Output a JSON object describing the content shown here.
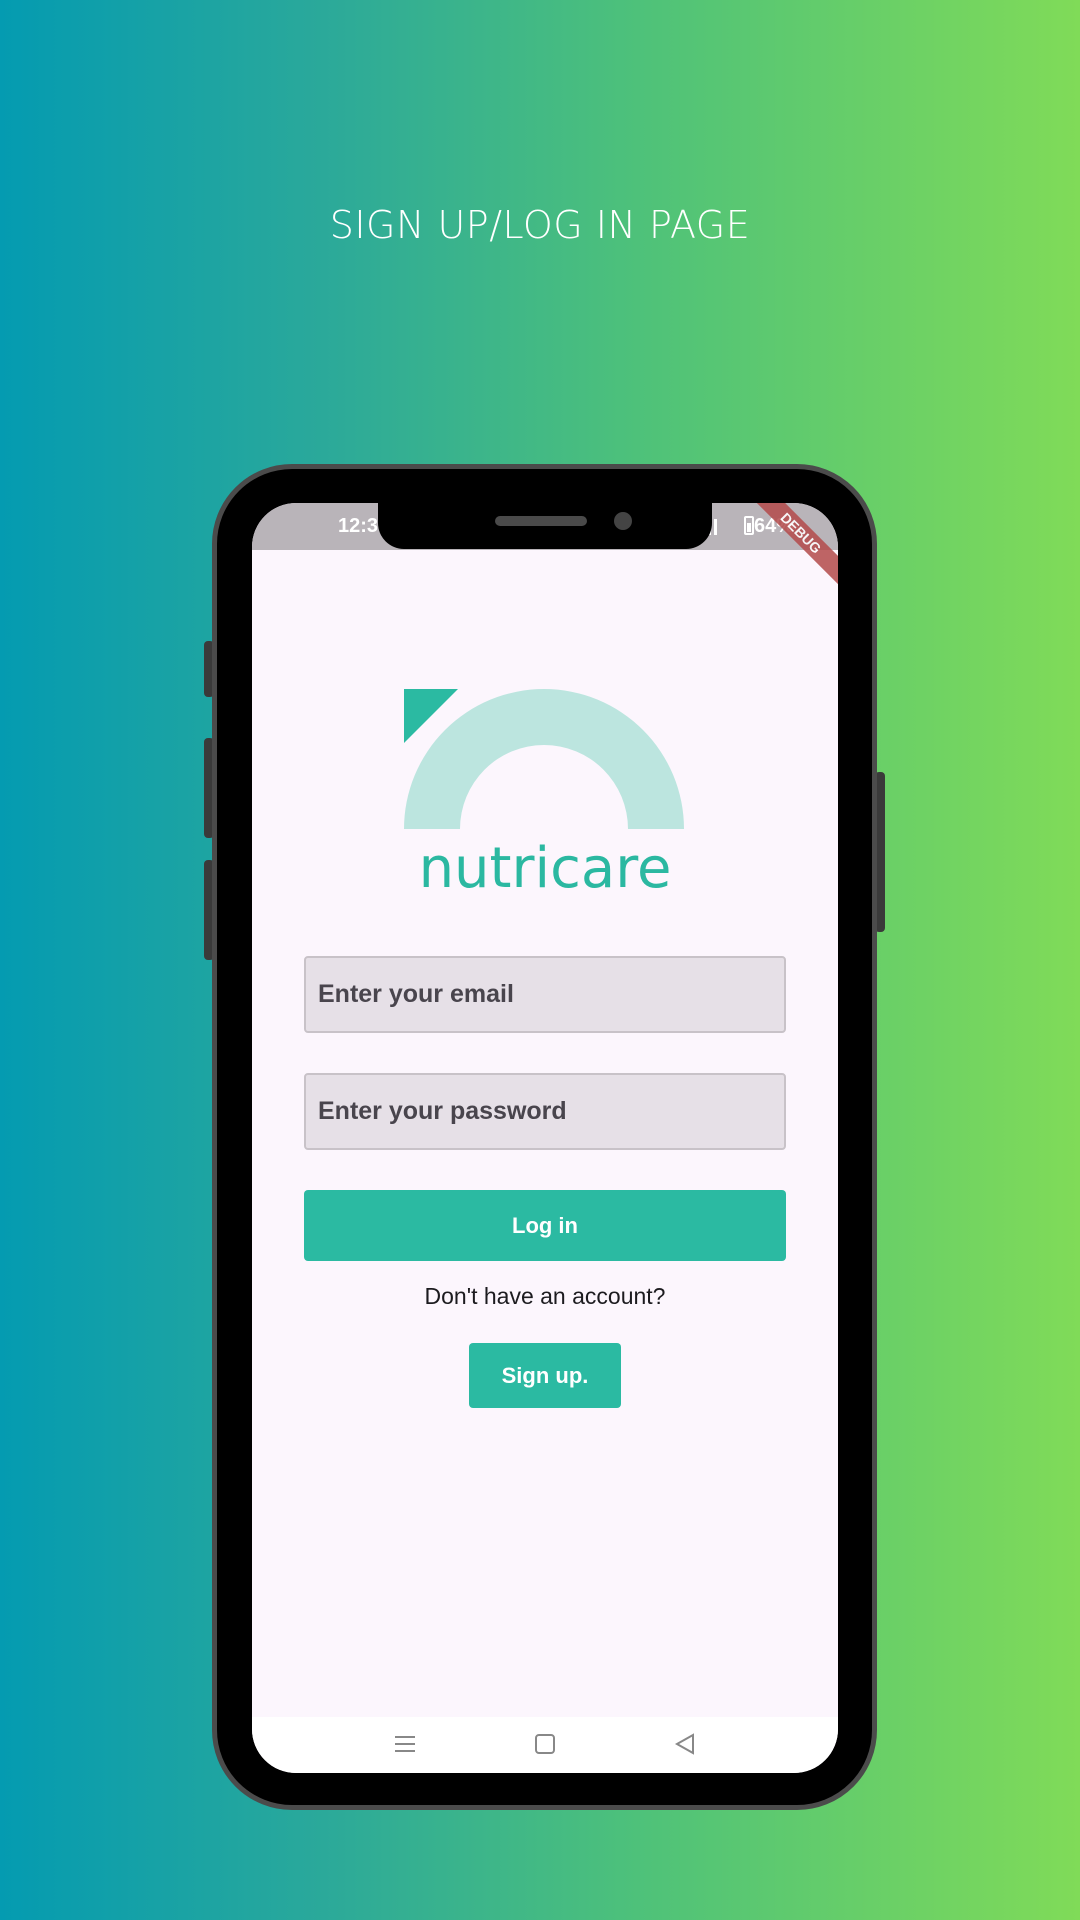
{
  "heading": "SIGN UP/LOG IN PAGE",
  "status": {
    "time": "12:3",
    "battery": "64%"
  },
  "debug_banner": "DEBUG",
  "brand": {
    "name": "nutricare",
    "color": "#2bb8a1"
  },
  "form": {
    "email_placeholder": "Enter your email",
    "password_placeholder": "Enter your password",
    "login_label": "Log in",
    "account_prompt": "Don't have an account?",
    "signup_label": "Sign up."
  },
  "nav": {
    "menu_icon": "menu-icon",
    "home_icon": "home-icon",
    "back_icon": "back-icon"
  },
  "colors": {
    "accent": "#2bbaa2",
    "screen_bg": "#fcf6fd",
    "field_bg": "#e6e0e7"
  }
}
